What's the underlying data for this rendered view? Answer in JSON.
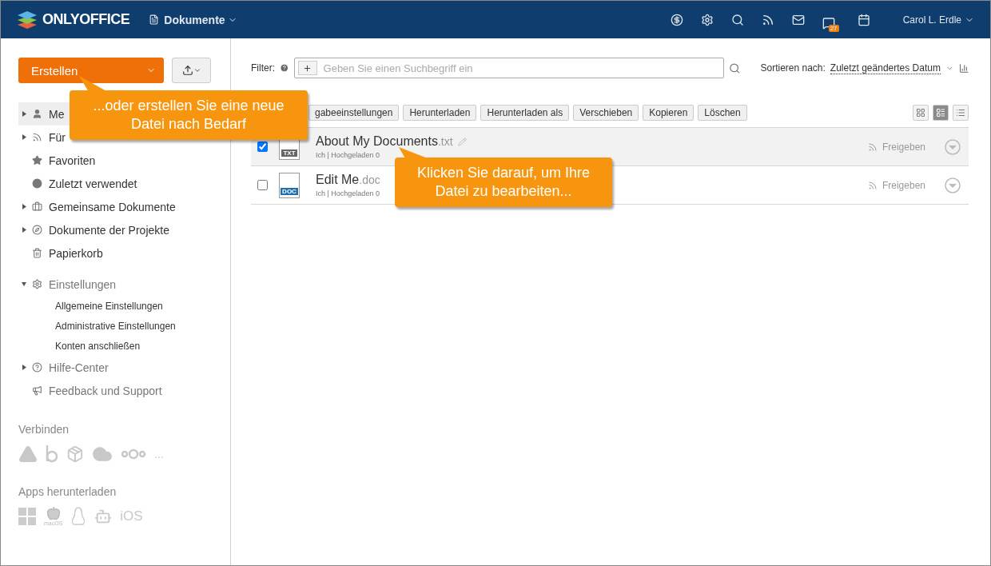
{
  "header": {
    "logo": "ONLYOFFICE",
    "module": "Dokumente",
    "badge": "27",
    "user": "Carol L. Erdle"
  },
  "sidebar": {
    "create_button": "Erstellen",
    "items": [
      {
        "label": "Me",
        "expandable": true,
        "expanded": false,
        "selected": true
      },
      {
        "label": "Für",
        "expandable": true,
        "expanded": false,
        "selected": false
      },
      {
        "label": "Favoriten",
        "expandable": false,
        "selected": false
      },
      {
        "label": "Zuletzt verwendet",
        "expandable": false,
        "selected": false
      },
      {
        "label": "Gemeinsame Dokumente",
        "expandable": true,
        "expanded": false,
        "selected": false
      },
      {
        "label": "Dokumente der Projekte",
        "expandable": true,
        "expanded": false,
        "selected": false
      },
      {
        "label": "Papierkorb",
        "expandable": false,
        "selected": false
      },
      {
        "label": "Einstellungen",
        "expandable": true,
        "expanded": true,
        "selected": false,
        "children": [
          {
            "label": "Allgemeine Einstellungen"
          },
          {
            "label": "Administrative Einstellungen"
          },
          {
            "label": "Konten anschließen"
          }
        ]
      },
      {
        "label": "Hilfe-Center",
        "expandable": true,
        "expanded": false,
        "selected": false
      },
      {
        "label": "Feedback und Support",
        "expandable": false,
        "selected": false
      }
    ],
    "connect": {
      "label": "Verbinden",
      "more": "..."
    },
    "apps": {
      "label": "Apps herunterladen",
      "macos": "macOS",
      "ios": "iOS"
    }
  },
  "filter": {
    "label": "Filter:",
    "placeholder": "Geben Sie einen Suchbegriff ein",
    "sort_label": "Sortieren nach:",
    "sort_value": "Zuletzt geändertes Datum"
  },
  "actions": [
    "gabeeinstellungen",
    "Herunterladen",
    "Herunterladen als",
    "Verschieben",
    "Kopieren",
    "Löschen"
  ],
  "views": [
    {
      "kind": "tiles",
      "selected": false
    },
    {
      "kind": "compact",
      "selected": true
    },
    {
      "kind": "list",
      "selected": false
    }
  ],
  "files": [
    {
      "name": "About My Documents",
      "ext": ".txt",
      "kind": "text",
      "tag": "TXT",
      "checked": true,
      "meta": "Ich | Hochgeladen 0",
      "share": "Freigeben"
    },
    {
      "name": "Edit Me",
      "ext": ".doc",
      "kind": "word",
      "tag": "DOC",
      "checked": false,
      "meta": "Ich | Hochgeladen 0",
      "share": "Freigeben"
    }
  ],
  "callouts": [
    {
      "text": "...oder erstellen Sie eine neue Datei nach Bedarf"
    },
    {
      "text": "Klicken Sie darauf, um Ihre Datei zu bearbeiten..."
    }
  ]
}
